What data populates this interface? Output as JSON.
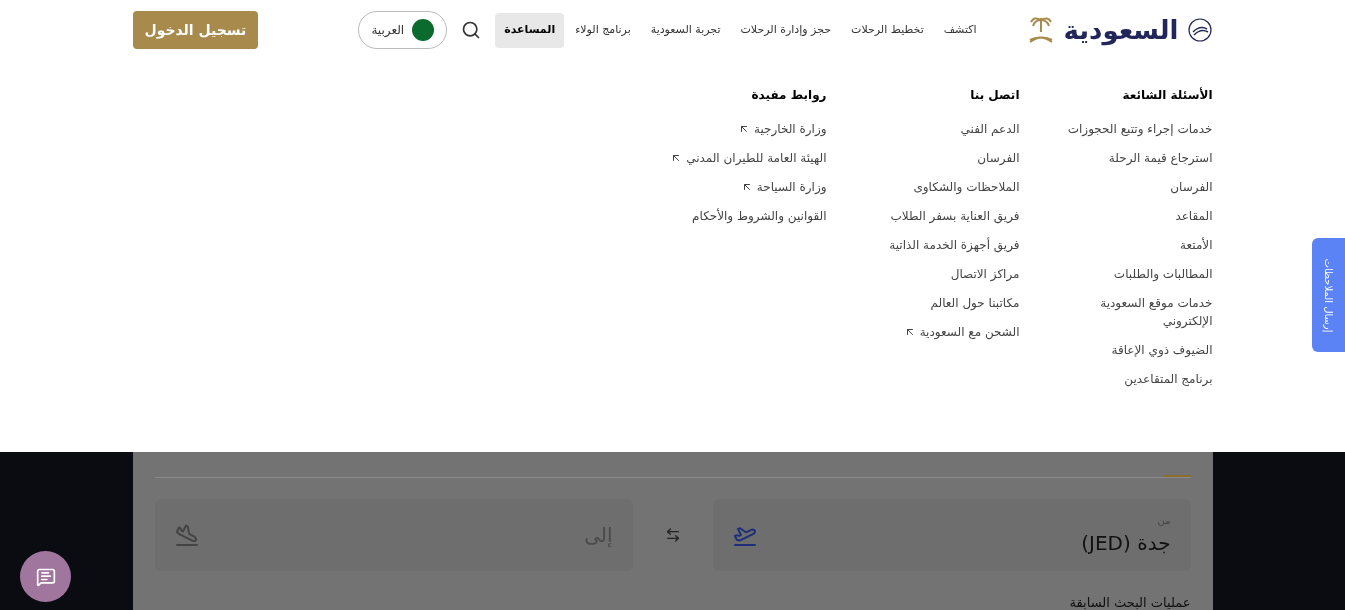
{
  "header": {
    "logo_text": "السعودية",
    "nav": [
      {
        "label": "اكتشف",
        "selected": false
      },
      {
        "label": "تخطيط الرحلات",
        "selected": false
      },
      {
        "label": "حجز وإدارة الرحلات",
        "selected": false
      },
      {
        "label": "تجربة السعودية",
        "selected": false
      },
      {
        "label": "برنامج الولاء",
        "selected": false
      },
      {
        "label": "المساعدة",
        "selected": true
      }
    ],
    "language": "العربية",
    "login": "تسجيل الدخول"
  },
  "menu": {
    "columns": [
      {
        "heading": "الأسئلة الشائعة",
        "links": [
          {
            "label": "خدمات إجراء وتتبع الحجوزات",
            "external": false
          },
          {
            "label": "استرجاع قيمة الرحلة",
            "external": false
          },
          {
            "label": "الفرسان",
            "external": false
          },
          {
            "label": "المقاعد",
            "external": false
          },
          {
            "label": "الأمتعة",
            "external": false
          },
          {
            "label": "المطالبات والطلبات",
            "external": false
          },
          {
            "label": "خدمات موقع السعودية الإلكتروني",
            "external": false
          },
          {
            "label": "الضيوف ذوي الإعاقة",
            "external": false
          },
          {
            "label": "برنامج المتقاعدين",
            "external": false
          }
        ]
      },
      {
        "heading": "اتصل بنا",
        "links": [
          {
            "label": "الدعم الفني",
            "external": false
          },
          {
            "label": "الفرسان",
            "external": false
          },
          {
            "label": "الملاحظات والشكاوى",
            "external": false
          },
          {
            "label": "فريق العناية بسفر الطلاب",
            "external": false
          },
          {
            "label": "فريق أجهزة الخدمة الذاتية",
            "external": false
          },
          {
            "label": "مراكز الاتصال",
            "external": false
          },
          {
            "label": "مكاتبنا حول العالم",
            "external": false
          },
          {
            "label": "الشحن مع السعودية",
            "external": true
          }
        ]
      },
      {
        "heading": "روابط مفيدة",
        "links": [
          {
            "label": "وزارة الخارجية",
            "external": true
          },
          {
            "label": "الهيئة العامة للطيران المدني",
            "external": true
          },
          {
            "label": "وزارة السياحة",
            "external": true
          },
          {
            "label": "القوانين والشروط والأحكام",
            "external": false
          }
        ]
      }
    ]
  },
  "feedback_tab": "إرسال الملاحظات",
  "booking": {
    "from_label": "من",
    "from_value": "جدة (JED)",
    "to_placeholder": "إلى",
    "recent_searches": "عمليات البحث السابقة"
  }
}
